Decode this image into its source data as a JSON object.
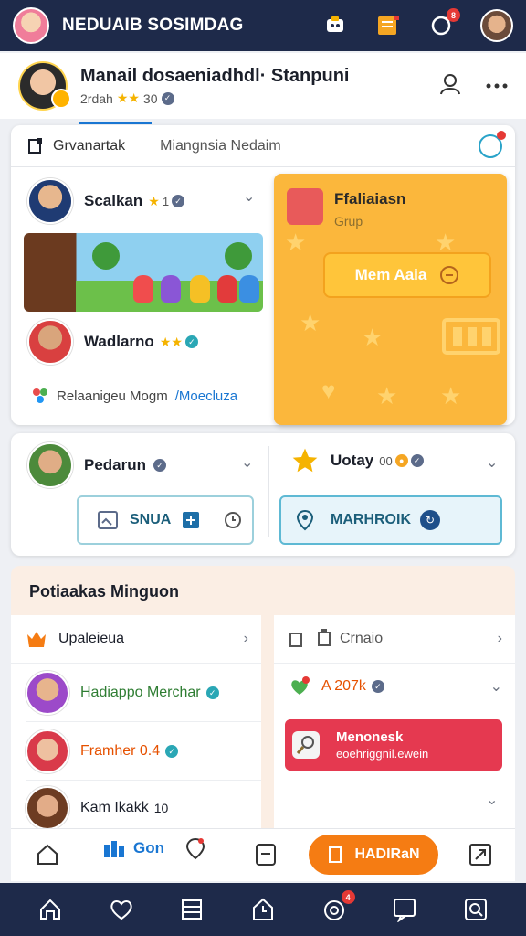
{
  "topbar": {
    "title": "NEDUAIB SOSIMDAG",
    "icons": [
      "app-avatar",
      "chat-bubble-icon",
      "folder-icon",
      "refresh-icon",
      "user-avatar"
    ],
    "notification_badge": "8"
  },
  "profile": {
    "name": "Manail dosaeniadhdl· Stanpuni",
    "subtitle_prefix": "2rdah",
    "subtitle_count": "30"
  },
  "tabs": [
    {
      "label": "Grvanartak",
      "active": true
    },
    {
      "label": "Miangnsia Nedaim",
      "active": false
    }
  ],
  "feed": {
    "item1": {
      "name": "Scalkan",
      "meta": "1"
    },
    "item2": {
      "name": "Wadlarno"
    },
    "share_text": "Relaanigeu Mogm",
    "share_link": "/Moecluza"
  },
  "promo": {
    "title": "Ffaliaiasn",
    "subtitle": "Grup",
    "button_label": "Mem Aaia",
    "bg_color": "#fbb73c"
  },
  "card2": {
    "left_name": "Pedarun",
    "left_button": "SNUA",
    "right_name": "Uotay",
    "right_meta": "00",
    "right_button": "MARHROIK"
  },
  "section": {
    "title": "Potiaakas Minguon",
    "left_header": "Upaleieua",
    "right_header": "Crnaio",
    "list": [
      {
        "name": "Hadiappo Merchar",
        "color": "green"
      },
      {
        "name": "Framher 0.4",
        "color": "orange"
      },
      {
        "name": "Kam Ikakk",
        "meta": "10"
      }
    ],
    "right_item": {
      "name": "A 207k"
    },
    "pink_card": {
      "title": "Menonesk",
      "subtitle": "eoehriggnil.ewein",
      "color": "#e53950"
    }
  },
  "bottom_nav": {
    "go_label": "Gon",
    "cta_label": "HADIRaN",
    "cta_color": "#f57c13"
  },
  "system_nav": {
    "icons": [
      "home-icon",
      "heart-icon",
      "list-icon",
      "home-box-icon",
      "target-icon",
      "chat-icon",
      "search-box-icon"
    ],
    "badge": "4"
  }
}
